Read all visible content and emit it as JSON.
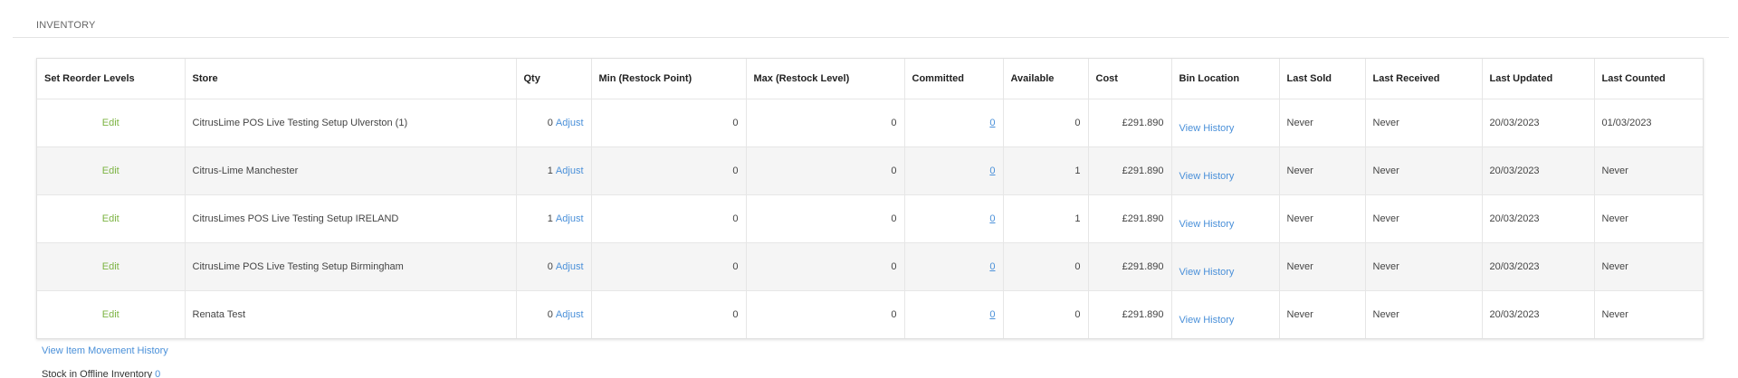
{
  "section": {
    "title": "INVENTORY"
  },
  "table": {
    "headers": [
      "Set Reorder Levels",
      "Store",
      "Qty",
      "Min (Restock Point)",
      "Max (Restock Level)",
      "Committed",
      "Available",
      "Cost",
      "Bin Location",
      "Last Sold",
      "Last Received",
      "Last Updated",
      "Last Counted"
    ],
    "rows": [
      {
        "edit": "Edit",
        "store": "CitrusLime POS Live Testing Setup Ulverston (1)",
        "qty": "0",
        "adjust": "Adjust",
        "min": "0",
        "max": "0",
        "committed": "0",
        "available": "0",
        "cost": "£291.890",
        "bin": "View History",
        "last_sold": "Never",
        "last_received": "Never",
        "last_updated": "20/03/2023",
        "last_counted": "01/03/2023"
      },
      {
        "edit": "Edit",
        "store": "Citrus-Lime Manchester",
        "qty": "1",
        "adjust": "Adjust",
        "min": "0",
        "max": "0",
        "committed": "0",
        "available": "1",
        "cost": "£291.890",
        "bin": "View History",
        "last_sold": "Never",
        "last_received": "Never",
        "last_updated": "20/03/2023",
        "last_counted": "Never"
      },
      {
        "edit": "Edit",
        "store": "CitrusLimes POS Live Testing Setup IRELAND",
        "qty": "1",
        "adjust": "Adjust",
        "min": "0",
        "max": "0",
        "committed": "0",
        "available": "1",
        "cost": "£291.890",
        "bin": "View History",
        "last_sold": "Never",
        "last_received": "Never",
        "last_updated": "20/03/2023",
        "last_counted": "Never"
      },
      {
        "edit": "Edit",
        "store": "CitrusLime POS Live Testing Setup Birmingham",
        "qty": "0",
        "adjust": "Adjust",
        "min": "0",
        "max": "0",
        "committed": "0",
        "available": "0",
        "cost": "£291.890",
        "bin": "View History",
        "last_sold": "Never",
        "last_received": "Never",
        "last_updated": "20/03/2023",
        "last_counted": "Never"
      },
      {
        "edit": "Edit",
        "store": "Renata Test",
        "qty": "0",
        "adjust": "Adjust",
        "min": "0",
        "max": "0",
        "committed": "0",
        "available": "0",
        "cost": "£291.890",
        "bin": "View History",
        "last_sold": "Never",
        "last_received": "Never",
        "last_updated": "20/03/2023",
        "last_counted": "Never"
      }
    ]
  },
  "footer": {
    "movement_link": "View Item Movement History",
    "offline_label": "Stock in Offline Inventory",
    "offline_value": "0"
  },
  "colors": {
    "edit_green": "#7cb342",
    "link_blue": "#4a90d9",
    "row_alt": "#f5f5f5"
  }
}
